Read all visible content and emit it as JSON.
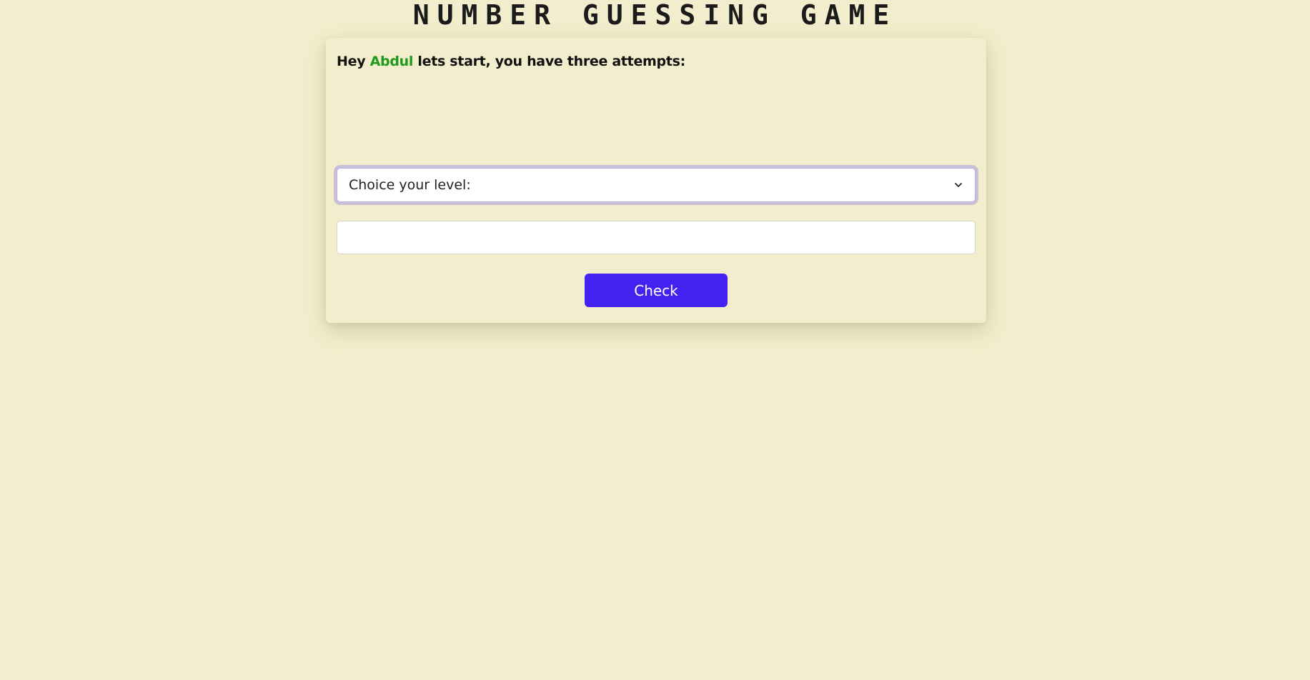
{
  "page": {
    "title": "NUMBER GUESSING GAME",
    "background_color": "#f2eecd"
  },
  "greeting": {
    "prefix": "Hey",
    "name": "Abdul",
    "suffix": "lets start, you have three attempts:",
    "name_color": "#1d9a1d"
  },
  "level_select": {
    "selected_label": "Choice your level:",
    "icon": "chevron-down-icon"
  },
  "guess_input": {
    "value": "",
    "placeholder": ""
  },
  "check_button": {
    "label": "Check",
    "color": "#4422f2"
  }
}
